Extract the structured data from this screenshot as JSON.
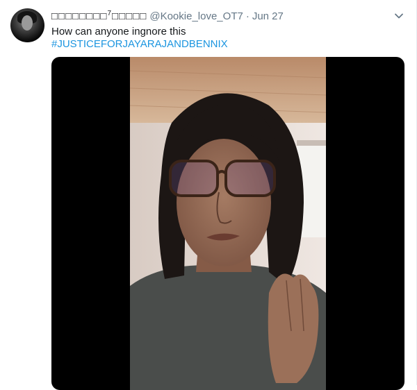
{
  "tweet": {
    "display_name": "□□□□□□□□",
    "display_name_sup": "7",
    "display_name_tail": "□□□□□",
    "handle": "@Kookie_love_OT7",
    "separator": "·",
    "date": "Jun 27",
    "text": "How can anyone ingnore this",
    "hashtag": "#JUSTICEFORJAYARAJANDBENNIX"
  },
  "icons": {
    "avatar": "profile-avatar",
    "caret": "chevron-down-icon"
  },
  "colors": {
    "link": "#1b95e0",
    "secondary_text": "#657786",
    "primary_text": "#14171a"
  }
}
